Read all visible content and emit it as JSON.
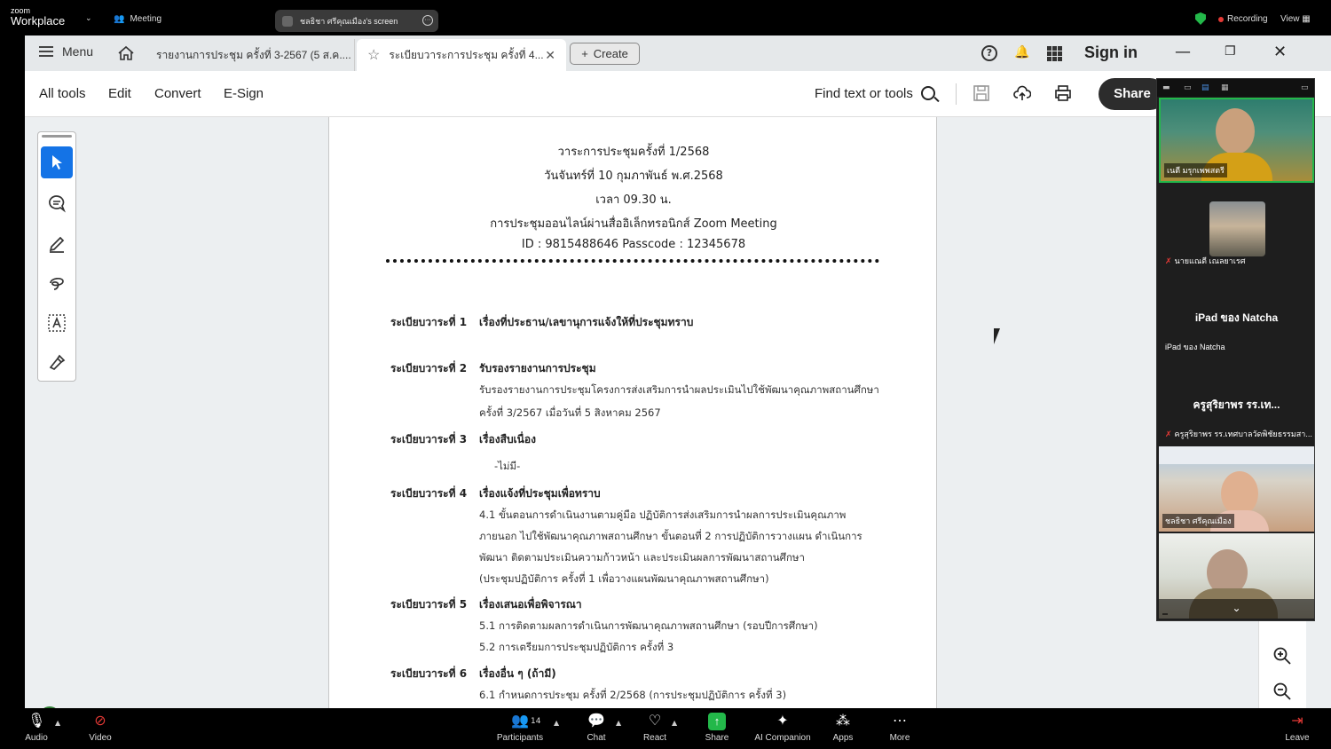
{
  "zoom": {
    "logo_top": "zoom",
    "logo_bottom": "Workplace",
    "meeting_label": "Meeting",
    "screen_share_label": "ชลธิชา ศรีคุณเมือง's screen",
    "recording_label": "Recording",
    "view_label": "View",
    "bottom": {
      "audio": "Audio",
      "video": "Video",
      "participants": "Participants",
      "participants_count": "14",
      "chat": "Chat",
      "react": "React",
      "share": "Share",
      "ai": "AI Companion",
      "apps": "Apps",
      "more": "More",
      "leave": "Leave"
    },
    "gallery": [
      {
        "name": "เนตี มรุกเพพสตรี",
        "has_video": true
      },
      {
        "name": "นายแณตี เณลยาเรศ",
        "has_video": true,
        "muted": true
      },
      {
        "center": "iPad ของ Natcha",
        "name": "iPad ของ Natcha",
        "has_video": false
      },
      {
        "center": "ครูสุริยาพร รร.เท...",
        "name": "ครูสุริยาพร รร.เทศบาลวัดพิชัยธรรมสา...",
        "has_video": false,
        "muted": true
      },
      {
        "name": "ชลธิชา ศรีคุณเมือง",
        "has_video": true
      },
      {
        "name": "",
        "has_video": true
      }
    ]
  },
  "acrobat": {
    "menu": "Menu",
    "tabs": [
      {
        "label": "รายงานการประชุม ครั้งที่ 3-2567 (5 ส.ค...."
      },
      {
        "label": "ระเบียบวาระการประชุม ครั้งที่ 4..."
      }
    ],
    "create": "Create",
    "signin": "Sign in",
    "tools": [
      "All tools",
      "Edit",
      "Convert",
      "E-Sign"
    ],
    "find": "Find text or tools",
    "share": "Share"
  },
  "document": {
    "title_lines": [
      "วาระการประชุมครั้งที่ 1/2568",
      "วันจันทร์ที่ 10 กุมภาพันธ์ พ.ศ.2568",
      "เวลา 09.30 น.",
      "การประชุมออนไลน์ผ่านสื่ออิเล็กทรอนิกส์ Zoom Meeting",
      "ID : 9815488646  Passcode : 12345678"
    ],
    "items": [
      {
        "label": "ระเบียบวาระที่ 1",
        "heading": "เรื่องที่ประธาน/เลขานุการแจ้งให้ที่ประชุมทราบ",
        "lines": []
      },
      {
        "label": "ระเบียบวาระที่ 2",
        "heading": "รับรองรายงานการประชุม",
        "lines": [
          "รับรองรายงานการประชุมโครงการส่งเสริมการนำผลประเมินไปใช้พัฒนาคุณภาพสถานศึกษา",
          "ครั้งที่ 3/2567 เมื่อวันที่ 5 สิงหาคม 2567"
        ]
      },
      {
        "label": "ระเบียบวาระที่ 3",
        "heading": "เรื่องสืบเนื่อง",
        "lines": [
          "-ไม่มี-"
        ]
      },
      {
        "label": "ระเบียบวาระที่ 4",
        "heading": "เรื่องแจ้งที่ประชุมเพื่อทราบ",
        "lines": [
          "4.1 ขั้นตอนการดำเนินงานตามคู่มือ ปฏิบัติการส่งเสริมการนำผลการประเมินคุณภาพ",
          "ภายนอก ไปใช้พัฒนาคุณภาพสถานศึกษา ขั้นตอนที่ 2 การปฏิบัติการวางแผน ดำเนินการ",
          "พัฒนา ติดตามประเมินความก้าวหน้า และประเมินผลการพัฒนาสถานศึกษา",
          "(ประชุมปฏิบัติการ ครั้งที่ 1 เพื่อวางแผนพัฒนาคุณภาพสถานศึกษา)"
        ]
      },
      {
        "label": "ระเบียบวาระที่ 5",
        "heading": "เรื่องเสนอเพื่อพิจารณา",
        "lines": [
          "5.1 การติดตามผลการดำเนินการพัฒนาคุณภาพสถานศึกษา (รอบปีการศึกษา)",
          "5.2 การเตรียมการประชุมปฏิบัติการ ครั้งที่ 3"
        ]
      },
      {
        "label": "ระเบียบวาระที่ 6",
        "heading": "เรื่องอื่น ๆ (ถ้ามี)",
        "lines": [
          "6.1 กำหนดการประชุม ครั้งที่ 2/2568 (การประชุมปฏิบัติการ ครั้งที่ 3)"
        ]
      }
    ]
  }
}
